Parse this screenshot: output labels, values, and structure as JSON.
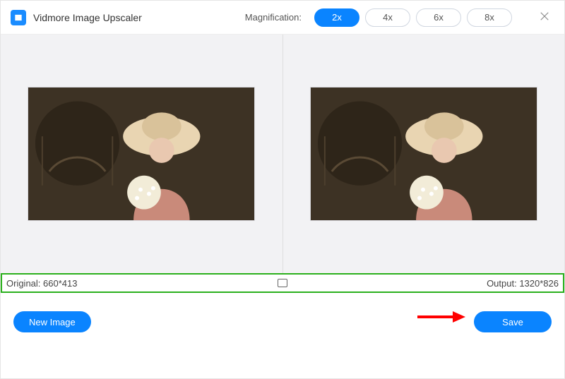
{
  "app": {
    "title": "Vidmore Image Upscaler"
  },
  "magnification": {
    "label": "Magnification:",
    "options": [
      "2x",
      "4x",
      "6x",
      "8x"
    ],
    "active": "2x"
  },
  "info": {
    "original_label": "Original:",
    "original_dims": "660*413",
    "output_label": "Output:",
    "output_dims": "1320*826"
  },
  "buttons": {
    "new_image": "New Image",
    "save": "Save"
  },
  "colors": {
    "accent": "#0a84ff",
    "highlight_border": "#2bb01d"
  }
}
